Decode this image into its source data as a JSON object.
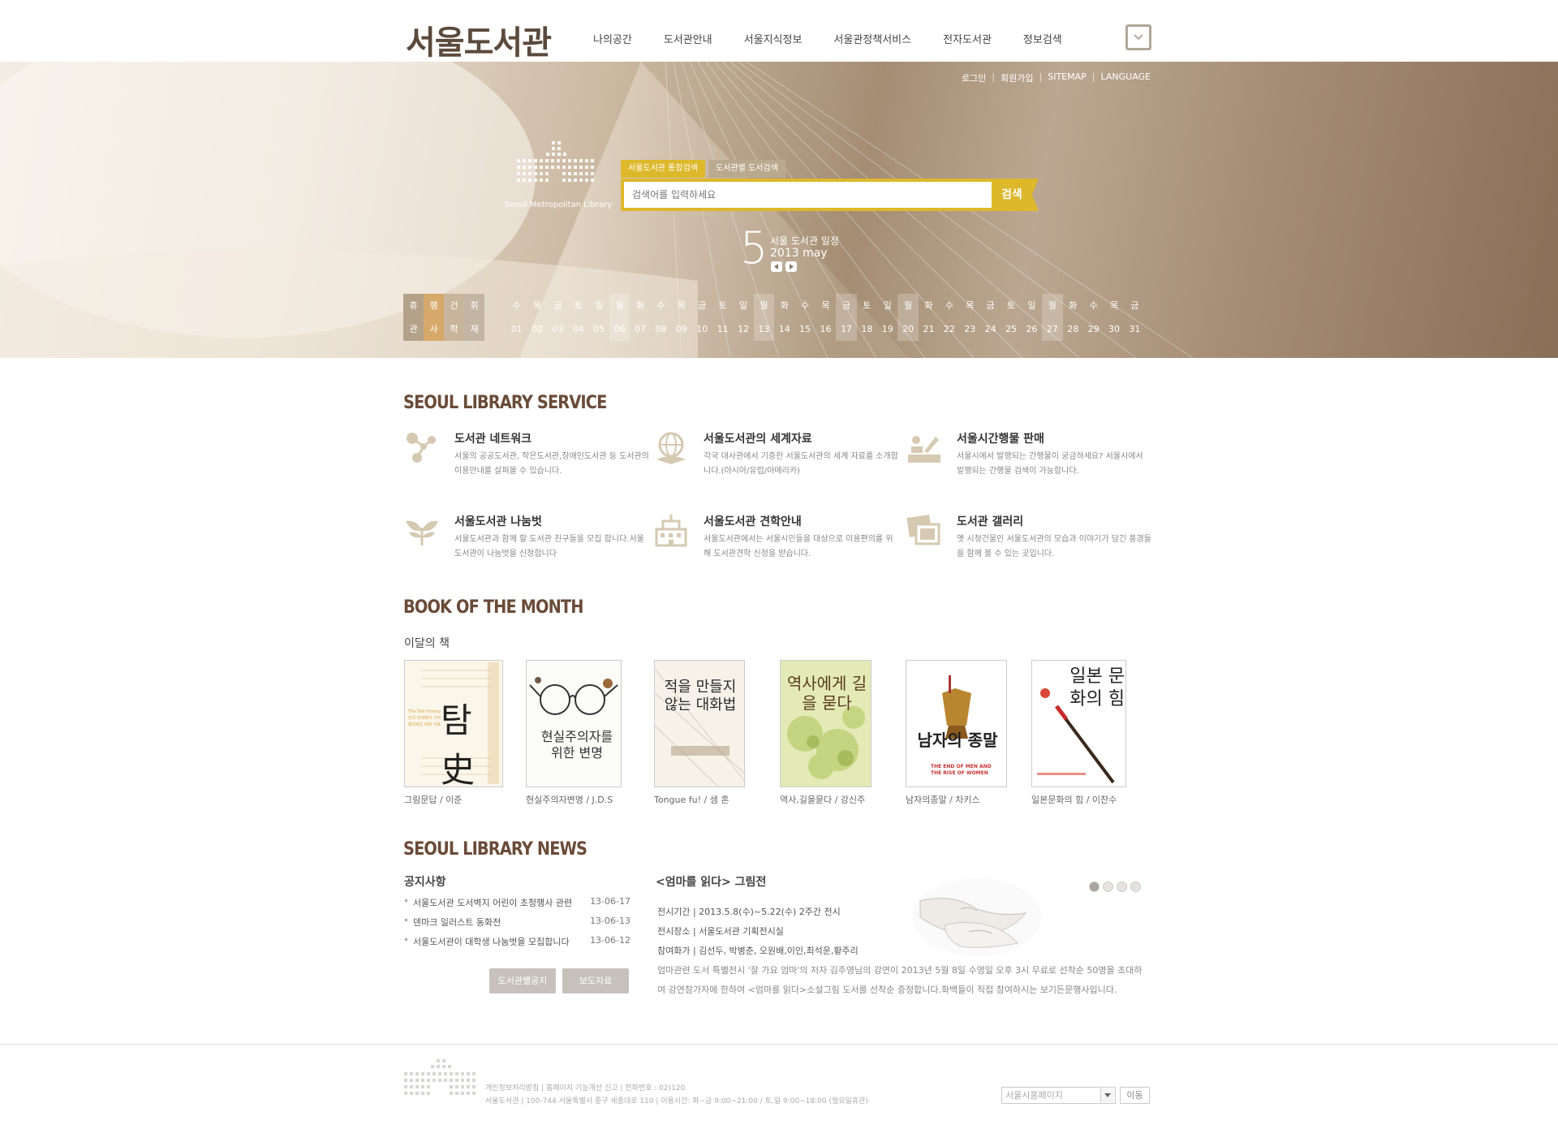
{
  "header": {
    "logo": "서울도서관",
    "nav": [
      "나의공간",
      "도서관안내",
      "서울지식정보",
      "서울관정책서비스",
      "전자도서관",
      "정보검색"
    ]
  },
  "utility": [
    "로그인",
    "회원가입",
    "SITEMAP",
    "LANGUAGE"
  ],
  "hero": {
    "logo_text": "Seoul Metropolitan Library",
    "search_tabs": [
      "서울도서관 통합검색",
      "도서관별 도서검색"
    ],
    "search_placeholder": "검색어를 입력하세요",
    "search_button": "검색",
    "month_number": "5",
    "month_title": "서울 도서관 일정",
    "month_year": "2013 may",
    "legend": [
      "휴",
      "행",
      "건",
      "휘",
      "관",
      "사",
      "학",
      "재"
    ],
    "calendar_weekdays": [
      "수",
      "목",
      "금",
      "토",
      "일",
      "월",
      "화",
      "수",
      "목",
      "금",
      "토",
      "일",
      "월",
      "화",
      "수",
      "목",
      "금",
      "토",
      "일",
      "월",
      "화",
      "수",
      "목",
      "금",
      "토",
      "일",
      "월",
      "화",
      "수",
      "목",
      "금"
    ],
    "calendar_days": [
      "01",
      "02",
      "03",
      "04",
      "05",
      "06",
      "07",
      "08",
      "09",
      "10",
      "11",
      "12",
      "13",
      "14",
      "15",
      "16",
      "17",
      "18",
      "19",
      "20",
      "21",
      "22",
      "23",
      "24",
      "25",
      "26",
      "27",
      "28",
      "29",
      "30",
      "31"
    ],
    "highlighted_days": [
      6,
      13,
      17,
      20,
      27
    ]
  },
  "service": {
    "title": "SEOUL LIBRARY SERVICE",
    "items": [
      {
        "title": "도서관 네트워크",
        "desc": "서울의 공공도서관, 작은도서관,장애인도서관 등 도서관의 이용안내를 살펴볼 수 있습니다.",
        "icon": "network-icon"
      },
      {
        "title": "서울도서관의 세계자료",
        "desc": "각국 대사관에서 기증한 서울도서관의 세계 자료를 소개합니다.(아시아/유럽/아메리카)",
        "icon": "globe-icon"
      },
      {
        "title": "서울시간행물 판매",
        "desc": "서울시에서 발행되는 간행물이 궁금하세요? 서울시에서 발행되는 간행물 검색이 가능합니다.",
        "icon": "publication-icon"
      },
      {
        "title": "서울도서관 나눔벗",
        "desc": "서울도서관과 함께 할 도서관 친구들을 모집 합니다.서울도서관이 나눔벗을 신청합니다",
        "icon": "sprout-icon"
      },
      {
        "title": "서울도서관 견학안내",
        "desc": "서울도서관에서는 서울시민들을 대상으로 이용편의를 위해 도서관견학 신청을 받습니다.",
        "icon": "building-icon"
      },
      {
        "title": "도서관 갤러리",
        "desc": "옛 시청건물인 서울도서관의 모습과 이야기가 담긴 풍경들을 함께 볼 수 있는 곳입니다.",
        "icon": "gallery-icon"
      }
    ]
  },
  "books": {
    "title": "BOOK OF THE MONTH",
    "subtitle": "이달의 책",
    "items": [
      {
        "caption": "그림문답 / 이준",
        "cover_text": "탐史",
        "bg": "#f8f4ea",
        "color": "#222"
      },
      {
        "caption": "현실주의자변명 / J.D.S",
        "cover_text": "현실주의자를 위한 변명",
        "bg": "#fbfbf8",
        "color": "#333"
      },
      {
        "caption": "Tongue fu! / 샘 혼",
        "cover_text": "적을 만들지 않는 대화법",
        "bg": "#f7f4ef",
        "color": "#2b2b2b"
      },
      {
        "caption": "역사,길을묻다 / 강신주",
        "cover_text": "역사에게 길을 묻다",
        "bg": "#e6ecbf",
        "color": "#5a3b1e"
      },
      {
        "caption": "남자의종말 / 차키스",
        "cover_text": "남자의 종말",
        "bg": "#ffffff",
        "color": "#1f1f1f"
      },
      {
        "caption": "일본문화의 힘 / 이찬수",
        "cover_text": "일본 문화의 힘",
        "bg": "#ffffff",
        "color": "#222"
      }
    ]
  },
  "news": {
    "title": "SEOUL LIBRARY NEWS",
    "notice_title": "공지사항",
    "notices": [
      {
        "text": "서울도서관 도서벽지 어린이 초청행사 관련",
        "date": "13-06-17"
      },
      {
        "text": "덴마크 일러스트 동화전",
        "date": "13-06-13"
      },
      {
        "text": "서울도서관이 대학생 나눔벗을 모집합니다",
        "date": "13-06-12"
      }
    ],
    "buttons": [
      "도서관별공지",
      "보도자료"
    ],
    "exhibit_title": "<엄마를 읽다> 그림전",
    "exhibit_lines": [
      "전시기간 | 2013.5.8(수)~5.22(수) 2주간 전시",
      "전시장소 | 서울도서관 기획전시실",
      "참여화가 | 김선두, 박병춘, 오원배,이인,최석운,황주리"
    ],
    "exhibit_desc": "엄마관련 도서 특별전시 '잘 가요 엄마'의 저자 김주영님의 강연이 2013년 5월 8일 수영일 오후 3시 무료로 선착순 50명을 초대하여 강연참가자에 한하여 <엄마를 읽다>소설그림 도서를 선착순 증정합니다.화백들이 직접 참여하시는 보기든문행사입니다."
  },
  "footer": {
    "line1": "개인정보처리방침  |  홈페이지 기능개선 신고 | 전화번호 : 02)120",
    "line2": "서울도서관 | 100-744 서울특별시 중구 세종대로 110 | 이용시간: 화~금 9:00~21:00 / 토,일 9:00~18:00 (월요일휴관)",
    "select_value": "서울시홈페이지",
    "go_button": "이동"
  }
}
